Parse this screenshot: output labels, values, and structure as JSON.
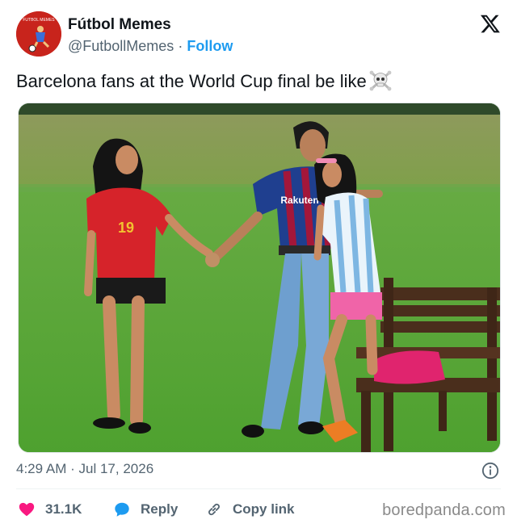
{
  "post": {
    "author": {
      "name": "Fútbol Memes",
      "handle": "@FutbollMemes",
      "separator": "·",
      "follow_label": "Follow",
      "avatar_text": "FUTBOL MEMES"
    },
    "text": "Barcelona fans at the World Cup final be like",
    "text_emoji": "skull-crossbones-icon",
    "photo": {
      "sponsor_text": "Rakuten",
      "left_shirt_number": "19"
    },
    "meta": {
      "time": "4:29 AM",
      "separator": "·",
      "date": "Jul 17, 2026"
    },
    "actions": {
      "likes": "31.1K",
      "reply_label": "Reply",
      "copy_link_label": "Copy link"
    },
    "watermark": "boredpanda.com"
  },
  "colors": {
    "follow": "#1d9bf0",
    "like": "#f91880",
    "reply": "#1d9bf0",
    "grass": "#5cab3b",
    "muted": "#536471"
  }
}
